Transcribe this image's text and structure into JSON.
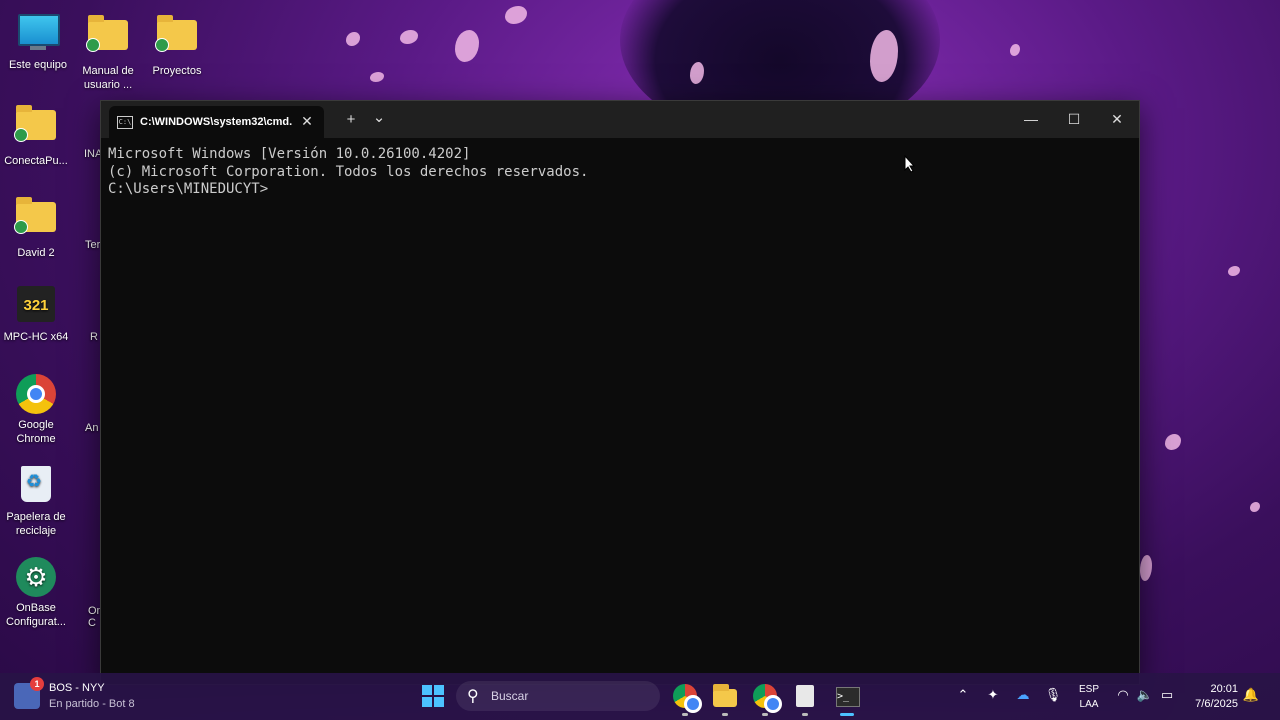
{
  "desktop": {
    "icons": [
      {
        "label": "Este equipo"
      },
      {
        "label": "Manual de usuario ..."
      },
      {
        "label": "Proyectos"
      },
      {
        "label": "ConectaPu..."
      },
      {
        "label": "David 2"
      },
      {
        "label": "MPC-HC x64"
      },
      {
        "label": "Google Chrome"
      },
      {
        "label": "Papelera de reciclaje"
      },
      {
        "label": "OnBase Configurat..."
      }
    ],
    "partial_labels": [
      "INA",
      "Ter",
      "R",
      "An",
      "On C"
    ]
  },
  "terminal": {
    "tab_title": "C:\\WINDOWS\\system32\\cmd.",
    "tab_icon_text": "C:\\",
    "new_tab": "+",
    "dropdown": "⌄",
    "minimize": "—",
    "maximize": "☐",
    "close": "✕",
    "lines": [
      "Microsoft Windows [Versión 10.0.26100.4202]",
      "(c) Microsoft Corporation. Todos los derechos reservados.",
      "",
      "C:\\Users\\MINEDUCYT>"
    ]
  },
  "taskbar": {
    "widget": {
      "badge": "1",
      "title": "BOS - NYY",
      "subtitle": "En partido - Bot 8"
    },
    "search_placeholder": "Buscar",
    "apps": [
      "chrome-icon",
      "file-explorer-icon",
      "chrome-alt-icon",
      "notepad-icon",
      "terminal-icon"
    ],
    "language": {
      "line1": "ESP",
      "line2": "LAA"
    },
    "clock": {
      "time": "20:01",
      "date": "7/6/2025"
    }
  }
}
